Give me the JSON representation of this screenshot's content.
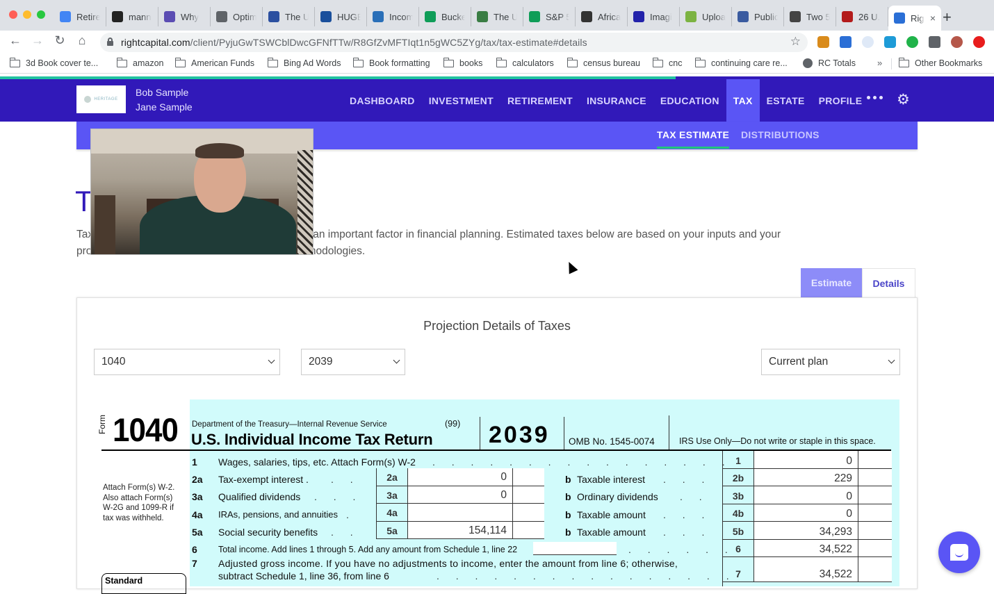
{
  "browser": {
    "tabs": [
      {
        "title": "Retire",
        "icon": "docs-icon",
        "color": "#4285f4"
      },
      {
        "title": "mann",
        "icon": "building-icon",
        "color": "#222222"
      },
      {
        "title": "Why",
        "icon": "grid-icon",
        "color": "#5b4db3"
      },
      {
        "title": "Optim",
        "icon": "globe-icon",
        "color": "#5f6368"
      },
      {
        "title": "The U",
        "icon": "shield-icon",
        "color": "#2b4fa0"
      },
      {
        "title": "HUGE",
        "icon": "gp-icon",
        "color": "#1a4f9c"
      },
      {
        "title": "Incom",
        "icon": "sync-icon",
        "color": "#2a6fb8"
      },
      {
        "title": "Bucke",
        "icon": "sheets-icon",
        "color": "#0f9d58"
      },
      {
        "title": "The U",
        "icon": "calc-icon",
        "color": "#3a7d44"
      },
      {
        "title": "S&P 5",
        "icon": "sheets-icon",
        "color": "#0f9d58"
      },
      {
        "title": "Africa",
        "icon": "s-icon",
        "color": "#333333"
      },
      {
        "title": "Imagi",
        "icon": "n-icon",
        "color": "#2222aa"
      },
      {
        "title": "Uploa",
        "icon": "play-icon",
        "color": "#7cb342"
      },
      {
        "title": "Public",
        "icon": "seal-icon",
        "color": "#3a5ba0"
      },
      {
        "title": "Two 5",
        "icon": "person-icon",
        "color": "#444444"
      },
      {
        "title": "26 U.",
        "icon": "lii-icon",
        "color": "#b31b1b"
      },
      {
        "title": "Rig",
        "icon": "rightcapital-icon",
        "color": "#2a6fd6",
        "active": true
      }
    ],
    "new_tab": "+",
    "close_tab": "×",
    "url_host": "rightcapital.com",
    "url_path": "/client/PyjuGwTSWCblDwcGFNfTTw/R8GfZvMFTIqt1n5gWC5ZYg/tax/tax-estimate#details",
    "bookmarks": [
      {
        "label": "3d Book cover te...",
        "icon": "folder-icon"
      },
      {
        "label": "amazon",
        "icon": "folder-icon"
      },
      {
        "label": "American Funds",
        "icon": "folder-icon"
      },
      {
        "label": "Bing Ad Words",
        "icon": "folder-icon"
      },
      {
        "label": "Book formatting",
        "icon": "folder-icon"
      },
      {
        "label": "books",
        "icon": "folder-icon"
      },
      {
        "label": "calculators",
        "icon": "folder-icon"
      },
      {
        "label": "census bureau",
        "icon": "folder-icon"
      },
      {
        "label": "cnc",
        "icon": "folder-icon"
      },
      {
        "label": "continuing care re...",
        "icon": "folder-icon"
      },
      {
        "label": "RC Totals",
        "icon": "globe-icon"
      }
    ],
    "bookmarks_overflow": "»",
    "other_bookmarks": "Other Bookmarks"
  },
  "app": {
    "colors": {
      "nav": "#3119b9",
      "subnav": "#5a55f5",
      "accent_green": "#22c77a",
      "form_band": "#d1fbfb"
    },
    "page_load_progress": 0.68,
    "logo_text": "HERITAGE",
    "clients": [
      "Bob Sample",
      "Jane Sample"
    ],
    "menu": [
      {
        "label": "DASHBOARD"
      },
      {
        "label": "INVESTMENT"
      },
      {
        "label": "RETIREMENT"
      },
      {
        "label": "INSURANCE"
      },
      {
        "label": "EDUCATION"
      },
      {
        "label": "TAX",
        "active": true
      },
      {
        "label": "ESTATE"
      },
      {
        "label": "PROFILE"
      }
    ],
    "submenu": {
      "active": "TAX ESTIMATE",
      "other": "DISTRIBUTIONS"
    },
    "page_title": "T",
    "intro_line1": "Tax                                                      ure and are an important factor in financial planning. Estimated taxes below are based on your inputs and your",
    "intro_line2": "pro                                                       es and methodologies.",
    "toggle": {
      "estimate": "Estimate",
      "details": "Details",
      "selected": "Details"
    },
    "card_title": "Projection Details of Taxes",
    "selects": {
      "form": "1040",
      "year": "2039",
      "plan": "Current plan"
    }
  },
  "form1040": {
    "form_word": "Form",
    "form_number": "1040",
    "dept": "Department of the Treasury—Internal Revenue Service",
    "code": "(99)",
    "title": "U.S. Individual Income Tax Return",
    "year": "2039",
    "omb": "OMB No. 1545-0074",
    "irs_use": "IRS Use Only—Do not write or staple in this space.",
    "attach_note": "Attach Form(s) W-2. Also attach Form(s) W-2G and 1099-R if tax was withheld.",
    "standard_label": "Standard",
    "lines": {
      "l1": {
        "num": "1",
        "label": "Wages, salaries, tips, etc. Attach Form(s) W-2",
        "code": "1",
        "value": "0"
      },
      "l2": {
        "num": "2a",
        "label": "Tax-exempt interest .",
        "code_a": "2a",
        "value_a": "0",
        "b_label": "Taxable interest",
        "code_b": "2b",
        "value_b": "229"
      },
      "l3": {
        "num": "3a",
        "label": "Qualified dividends",
        "code_a": "3a",
        "value_a": "0",
        "b_label": "Ordinary dividends",
        "code_b": "3b",
        "value_b": "0"
      },
      "l4": {
        "num": "4a",
        "label": "IRAs, pensions, and annuities",
        "code_a": "4a",
        "value_a": "",
        "b_label": "Taxable amount",
        "code_b": "4b",
        "value_b": "0"
      },
      "l5": {
        "num": "5a",
        "label": "Social security benefits",
        "code_a": "5a",
        "value_a": "154,114",
        "b_label": "Taxable amount",
        "code_b": "5b",
        "value_b": "34,293"
      },
      "l6": {
        "num": "6",
        "label": "Total income. Add lines 1 through 5. Add any amount from Schedule 1, line 22",
        "code": "6",
        "value": "34,522"
      },
      "l7": {
        "num": "7",
        "label": "Adjusted gross income. If you have no adjustments to income, enter the amount from line 6; otherwise,",
        "label2": "subtract Schedule 1, line 36, from line 6",
        "code": "7",
        "value": "34,522"
      }
    },
    "b_marker": "b"
  }
}
